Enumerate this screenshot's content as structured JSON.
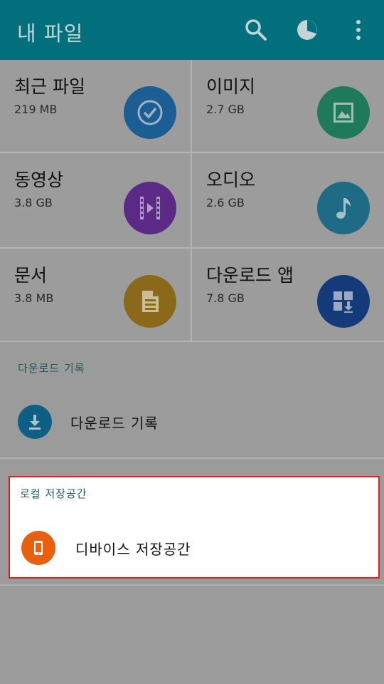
{
  "appbar": {
    "title": "내 파일",
    "background": "#016f7c",
    "icons": [
      "search-icon",
      "storage-chart-icon",
      "more-vert-icon"
    ]
  },
  "categories": [
    {
      "name": "최근 파일",
      "size": "219 MB",
      "icon": "clock-check-icon",
      "color": "#1a5e93"
    },
    {
      "name": "이미지",
      "size": "2.7 GB",
      "icon": "image-icon",
      "color": "#1f7a5c"
    },
    {
      "name": "동영상",
      "size": "3.8 GB",
      "icon": "video-icon",
      "color": "#5b2a87"
    },
    {
      "name": "오디오",
      "size": "2.6 GB",
      "icon": "music-note-icon",
      "color": "#1f6a84"
    },
    {
      "name": "문서",
      "size": "3.8 MB",
      "icon": "document-icon",
      "color": "#8a6a1a"
    },
    {
      "name": "다운로드 앱",
      "size": "7.8 GB",
      "icon": "app-download-icon",
      "color": "#143a7a"
    }
  ],
  "download_section": {
    "label": "다운로드 기록",
    "item": {
      "label": "다운로드 기록",
      "icon": "download-icon",
      "color": "#0e5f86"
    }
  },
  "local_section": {
    "label": "로컬 저장공간",
    "item": {
      "label": "디바이스 저장공간",
      "icon": "phone-icon",
      "color": "#e8600f"
    }
  }
}
